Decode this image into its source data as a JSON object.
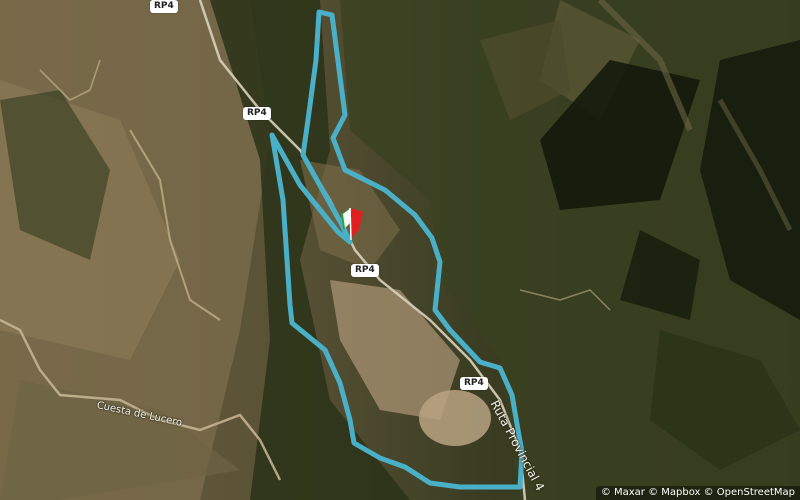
{
  "map": {
    "route_color": "#4ab0c8",
    "terrain_colors": {
      "dry_slope": "#8a7a58",
      "dark_forest": "#27301a",
      "shadow": "#141a0d",
      "clearing": "#b6a07e"
    },
    "road_badges": [
      "RP4",
      "RP4",
      "RP4",
      "RP4"
    ],
    "road_labels": {
      "cuesta": "Cuesta de Lucero",
      "ruta": "Ruta Provincial 4"
    },
    "marker": {
      "icon": "start-finish-flag-icon",
      "colors": [
        "#2aa34a",
        "#ffffff",
        "#e02020"
      ]
    },
    "attribution": "© Maxar © Mapbox © OpenStreetMap"
  }
}
